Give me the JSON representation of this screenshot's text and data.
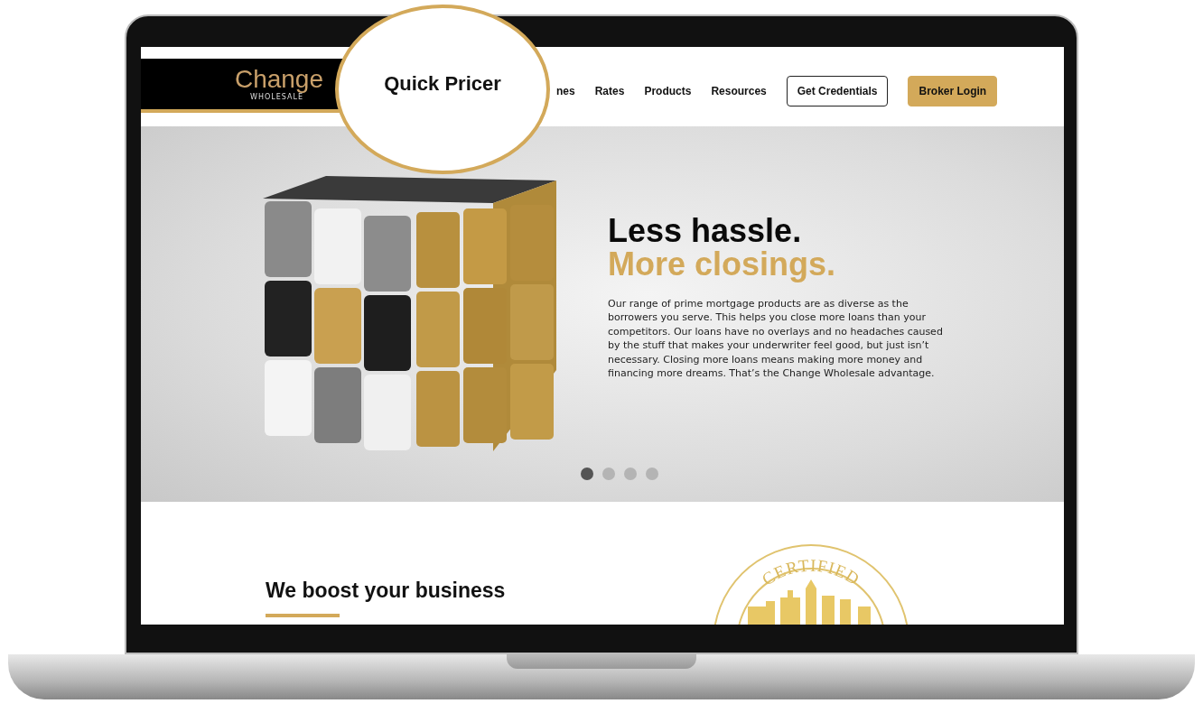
{
  "header": {
    "logo": {
      "name": "Change",
      "tagline": "WHOLESALE"
    },
    "nav": [
      {
        "label": "nes",
        "kind": "link"
      },
      {
        "label": "Rates",
        "kind": "link"
      },
      {
        "label": "Products",
        "kind": "link"
      },
      {
        "label": "Resources",
        "kind": "link"
      },
      {
        "label": "Get Credentials",
        "kind": "outline"
      },
      {
        "label": "Broker Login",
        "kind": "filled"
      }
    ]
  },
  "magnifier": {
    "label": "Quick Pricer"
  },
  "hero": {
    "headline": "Less hassle.",
    "headline_accent": "More closings.",
    "body": "Our range of prime mortgage products are as diverse as the borrowers you serve. This helps you close more loans than your competitors. Our loans have no overlays and no headaches caused by the stuff that makes your underwriter feel good, but just isn’t necessary. Closing more loans means making more money and financing more dreams. That’s the Change Wholesale advantage.",
    "slides": [
      {
        "selected": true
      },
      {
        "selected": false
      },
      {
        "selected": false
      },
      {
        "selected": false
      }
    ]
  },
  "section": {
    "heading": "We boost your business",
    "seal": {
      "text": "CERTIFIED"
    }
  }
}
